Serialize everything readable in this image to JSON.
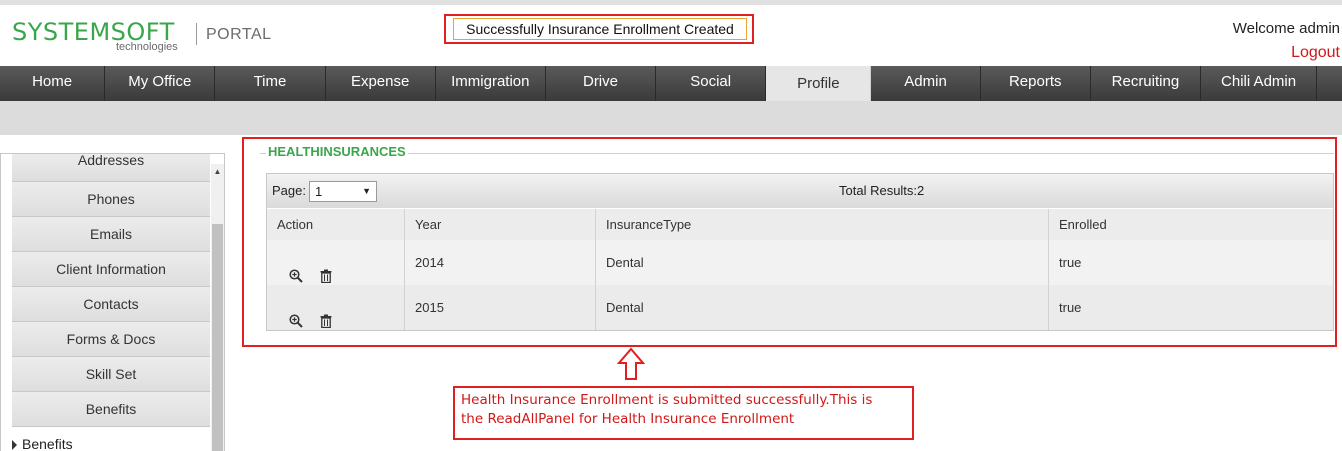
{
  "header": {
    "logo_main": "SYSTEMSOFT",
    "logo_sub": "technologies",
    "portal": "PORTAL",
    "alert": "Successfully Insurance Enrollment Created",
    "welcome": "Welcome admin",
    "logout": "Logout"
  },
  "nav": {
    "items": [
      "Home",
      "My Office",
      "Time",
      "Expense",
      "Immigration",
      "Drive",
      "Social",
      "Profile",
      "Admin",
      "Reports",
      "Recruiting",
      "Chili Admin"
    ],
    "active": "Profile"
  },
  "sidebar": {
    "items": [
      "Addresses",
      "Phones",
      "Emails",
      "Client Information",
      "Contacts",
      "Forms & Docs",
      "Skill Set",
      "Benefits"
    ],
    "tree_item": "Benefits"
  },
  "panel": {
    "legend": "HEALTHINSURANCES",
    "page_label": "Page:",
    "page_value": "1",
    "total_results": "Total Results:2",
    "columns": [
      "Action",
      "Year",
      "InsuranceType",
      "Enrolled"
    ],
    "rows": [
      {
        "year": "2014",
        "type": "Dental",
        "enrolled": "true"
      },
      {
        "year": "2015",
        "type": "Dental",
        "enrolled": "true"
      }
    ]
  },
  "annotation": {
    "line1": "Health Insurance Enrollment is submitted successfully.This is",
    "line2": "the ReadAllPanel for Health Insurance Enrollment"
  },
  "colors": {
    "brand_green": "#3aa64c",
    "highlight_red": "#e02020",
    "nav_dark": "#4a4a4a"
  }
}
